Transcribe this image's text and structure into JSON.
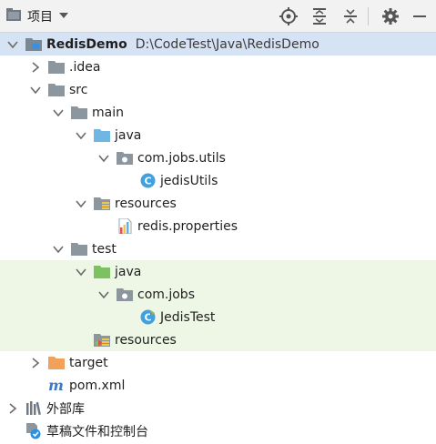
{
  "toolbar": {
    "title": "项目",
    "buttons": [
      {
        "icon": "locate-icon"
      },
      {
        "icon": "expand-all-icon"
      },
      {
        "icon": "collapse-all-icon"
      },
      {
        "icon": "gear-icon"
      },
      {
        "icon": "minimize-icon"
      }
    ]
  },
  "tree": [
    {
      "label": "RedisDemo",
      "path": "D:\\CodeTest\\Java\\RedisDemo",
      "icon": "module-folder-icon",
      "arrow": "down",
      "depth": 0,
      "bold": true,
      "state": "selected"
    },
    {
      "label": ".idea",
      "icon": "folder-icon",
      "arrow": "right",
      "depth": 1
    },
    {
      "label": "src",
      "icon": "folder-icon",
      "arrow": "down",
      "depth": 1
    },
    {
      "label": "main",
      "icon": "folder-icon",
      "arrow": "down",
      "depth": 2
    },
    {
      "label": "java",
      "icon": "source-folder-icon",
      "arrow": "down",
      "depth": 3
    },
    {
      "label": "com.jobs.utils",
      "icon": "package-icon",
      "arrow": "down",
      "depth": 4
    },
    {
      "label": "jedisUtils",
      "icon": "java-class-icon",
      "arrow": "none",
      "depth": 5
    },
    {
      "label": "resources",
      "icon": "resources-folder-icon",
      "arrow": "down",
      "depth": 3
    },
    {
      "label": "redis.properties",
      "icon": "properties-file-icon",
      "arrow": "none",
      "depth": 4
    },
    {
      "label": "test",
      "icon": "folder-icon",
      "arrow": "down",
      "depth": 2
    },
    {
      "label": "java",
      "icon": "test-source-folder-icon",
      "arrow": "down",
      "depth": 3,
      "state": "test"
    },
    {
      "label": "com.jobs",
      "icon": "package-icon",
      "arrow": "down",
      "depth": 4,
      "state": "test"
    },
    {
      "label": "JedisTest",
      "icon": "test-class-icon",
      "arrow": "none",
      "depth": 5,
      "state": "test"
    },
    {
      "label": "resources",
      "icon": "test-resources-folder-icon",
      "arrow": "none",
      "depth": 3,
      "state": "test"
    },
    {
      "label": "target",
      "icon": "excluded-folder-icon",
      "arrow": "right",
      "depth": 1
    },
    {
      "label": "pom.xml",
      "icon": "maven-icon",
      "arrow": "none",
      "depth": 1
    },
    {
      "label": "外部库",
      "icon": "libraries-icon",
      "arrow": "right",
      "depth": 0
    },
    {
      "label": "草稿文件和控制台",
      "icon": "scratches-icon",
      "arrow": "none",
      "depth": 0
    }
  ]
}
